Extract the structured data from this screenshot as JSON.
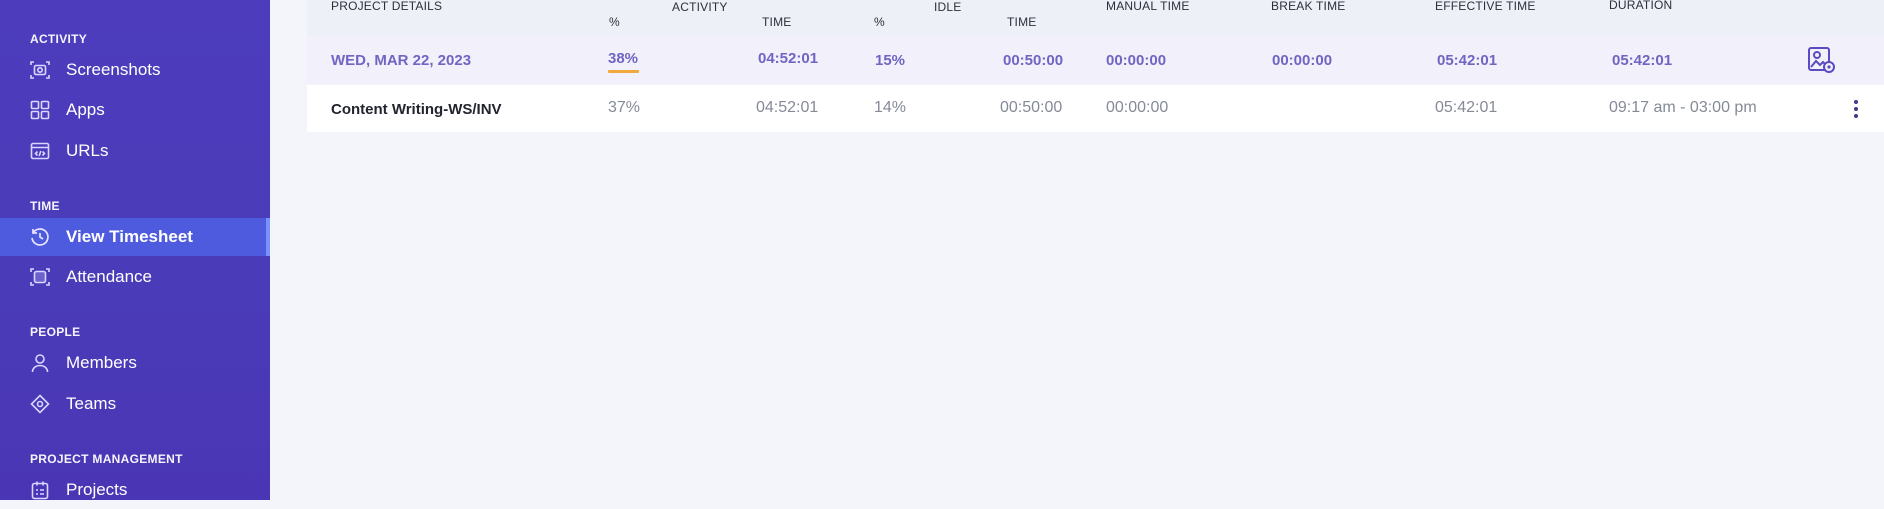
{
  "sidebar": {
    "sections": [
      {
        "title": "ACTIVITY",
        "items": [
          {
            "label": "Screenshots",
            "icon": "screenshot-icon"
          },
          {
            "label": "Apps",
            "icon": "apps-grid-icon"
          },
          {
            "label": "URLs",
            "icon": "url-browser-icon"
          }
        ]
      },
      {
        "title": "TIME",
        "items": [
          {
            "label": "View Timesheet",
            "icon": "timesheet-clock-icon",
            "active": true
          },
          {
            "label": "Attendance",
            "icon": "attendance-icon"
          }
        ]
      },
      {
        "title": "PEOPLE",
        "items": [
          {
            "label": "Members",
            "icon": "user-icon"
          },
          {
            "label": "Teams",
            "icon": "teams-icon"
          }
        ]
      },
      {
        "title": "PROJECT MANAGEMENT",
        "items": [
          {
            "label": "Projects",
            "icon": "projects-icon"
          }
        ]
      }
    ]
  },
  "table": {
    "headers": {
      "project_details": "PROJECT DETAILS",
      "activity_pct": "%",
      "activity": "ACTIVITY",
      "activity_time": "TIME",
      "idle_pct": "%",
      "idle": "IDLE",
      "idle_time": "TIME",
      "manual_time": "MANUAL TIME",
      "break_time": "BREAK TIME",
      "effective_time": "EFFECTIVE TIME",
      "duration": "DURATION"
    },
    "date_row": {
      "date": "WED, MAR 22, 2023",
      "activity_pct": "38%",
      "activity_time": "04:52:01",
      "idle_pct": "15%",
      "idle_time": "00:50:00",
      "manual_time": "00:00:00",
      "break_time": "00:00:00",
      "effective_time": "05:42:01",
      "duration": "05:42:01"
    },
    "project_row": {
      "name": "Content Writing-WS/INV",
      "activity_pct": "37%",
      "activity_time": "04:52:01",
      "idle_pct": "14%",
      "idle_time": "00:50:00",
      "manual_time": "00:00:00",
      "effective_time": "05:42:01",
      "duration": "09:17 am - 03:00 pm"
    }
  },
  "colors": {
    "sidebar_bg": "#4a3bb8",
    "active_item": "#4f5bdf",
    "accent_purple": "#7065c2",
    "underline_orange": "#f2a93b"
  }
}
